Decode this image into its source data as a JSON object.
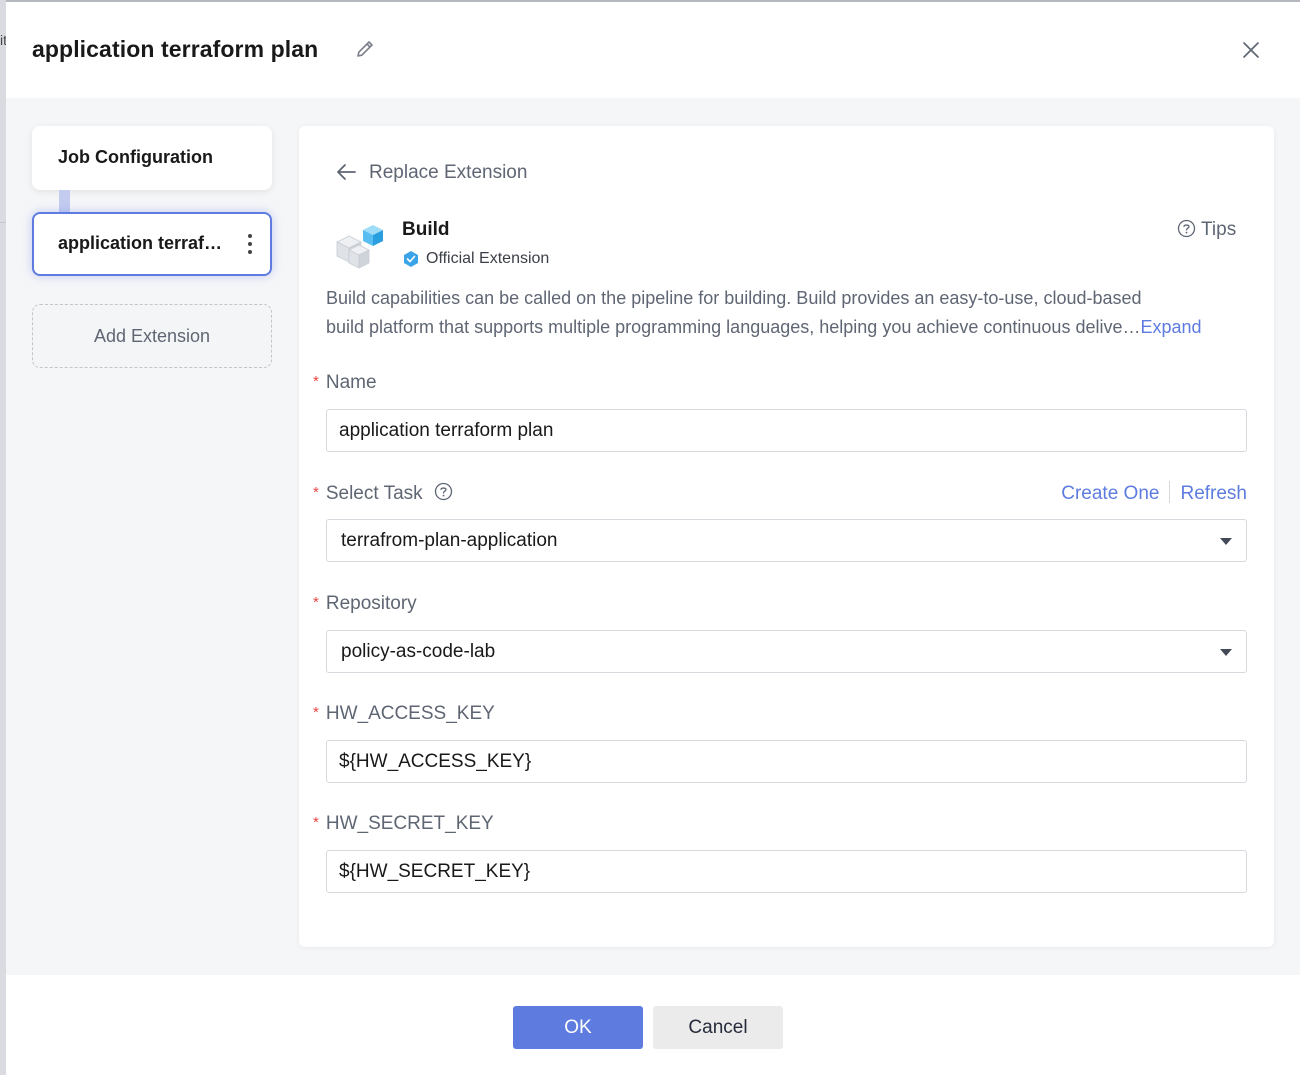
{
  "backdrop": {
    "partial_char": "it"
  },
  "dialog": {
    "title": "application terraform plan",
    "icons": {
      "edit": "pencil-icon",
      "close": "close-icon"
    }
  },
  "sidebar": {
    "job_configuration": "Job Configuration",
    "selected_item": "application terraform plan",
    "add_extension": "Add Extension"
  },
  "extension": {
    "replace_label": "Replace Extension",
    "name": "Build",
    "badge": "Official Extension",
    "tips": "Tips",
    "description_line1": "Build capabilities can be called on the pipeline for building. Build provides an easy-to-use, cloud-based",
    "description_line2": "build platform that supports multiple programming languages, helping you achieve continuous delive…",
    "expand": "Expand"
  },
  "form": {
    "name": {
      "label": "Name",
      "value": "application terraform plan"
    },
    "task": {
      "label": "Select Task",
      "value": "terrafrom-plan-application",
      "create": "Create One",
      "refresh": "Refresh"
    },
    "repository": {
      "label": "Repository",
      "value": "policy-as-code-lab"
    },
    "access_key": {
      "label": "HW_ACCESS_KEY",
      "value": "${HW_ACCESS_KEY}"
    },
    "secret_key": {
      "label": "HW_SECRET_KEY",
      "value": "${HW_SECRET_KEY}"
    }
  },
  "footer": {
    "ok": "OK",
    "cancel": "Cancel"
  },
  "colors": {
    "accent": "#5e7ce0",
    "required": "#e54545",
    "text_secondary": "#5f6673"
  }
}
